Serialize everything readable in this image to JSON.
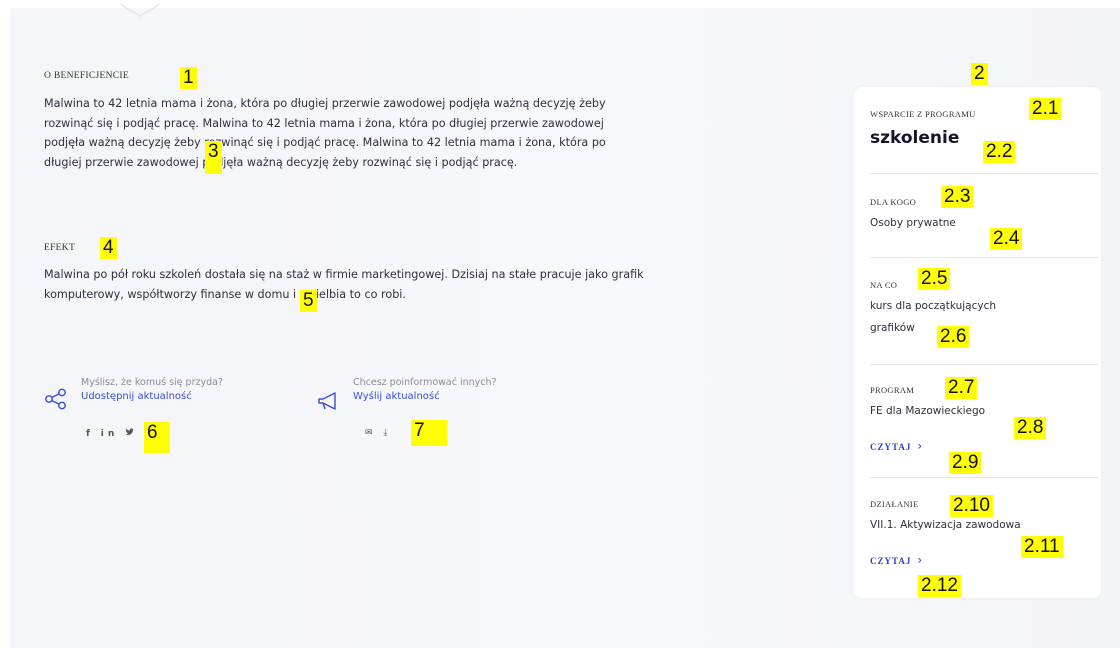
{
  "main": {
    "beneficiary_heading": "O BENEFICJENCIE",
    "beneficiary_text": "Malwina to 42 letnia mama i żona, która po długiej przerwie zawodowej podjęła ważną decyzję żeby rozwinąć się i podjąć pracę. Malwina to 42 letnia mama i żona, która po długiej przerwie zawodowej podjęła ważną decyzję żeby rozwinąć się i podjąć pracę. Malwina to 42 letnia mama i żona, która po długiej przerwie zawodowej podjęła ważną decyzję żeby rozwinąć się i podjąć pracę.",
    "effect_heading": "EFEKT",
    "effect_text": "Malwina po pół roku szkoleń dostała się na staż w firmie marketingowej. Dzisiaj na stałe pracuje jako grafik komputerowy, współtworzy finanse w domu i uwielbia to co robi.",
    "share": {
      "hint": "Myślisz, że komuś się przyda?",
      "link": "Udostępnij aktualność",
      "icons": [
        "facebook-icon",
        "linkedin-icon",
        "twitter-icon"
      ],
      "icon_glyphs": [
        "f",
        "in",
        "🐦"
      ]
    },
    "inform": {
      "hint": "Chcesz poinformować innych?",
      "link": "Wyślij aktualność",
      "icons": [
        "email-icon",
        "download-icon"
      ],
      "icon_glyphs": [
        "✉",
        "⤓"
      ]
    }
  },
  "card": {
    "support_caption": "WSPARCIE Z PROGRAMU",
    "support_value": "szkolenie",
    "for_whom_caption": "DLA KOGO",
    "for_whom_value": "Osoby prywatne",
    "for_what_caption": "NA CO",
    "for_what_value_line1": "kurs dla początkujących",
    "for_what_value_line2": "grafików",
    "program_caption": "PROGRAM",
    "program_value": "FE dla Mazowieckiego",
    "program_read": "CZYTAJ",
    "action_caption": "DZIAŁANIE",
    "action_value": "VII.1. Aktywizacja zawodowa",
    "action_read": "CZYTAJ"
  },
  "annotations": [
    "1",
    "2",
    "2.1",
    "2.2",
    "2.3",
    "2.4",
    "2.5",
    "2.6",
    "2.7",
    "2.8",
    "2.9",
    "2.10",
    "2.11",
    "2.12",
    "3",
    "4",
    "5",
    "6",
    "7"
  ],
  "colors": {
    "accent": "#3b4dd1",
    "highlight": "#ffff00",
    "background": "#f4f5f9"
  }
}
